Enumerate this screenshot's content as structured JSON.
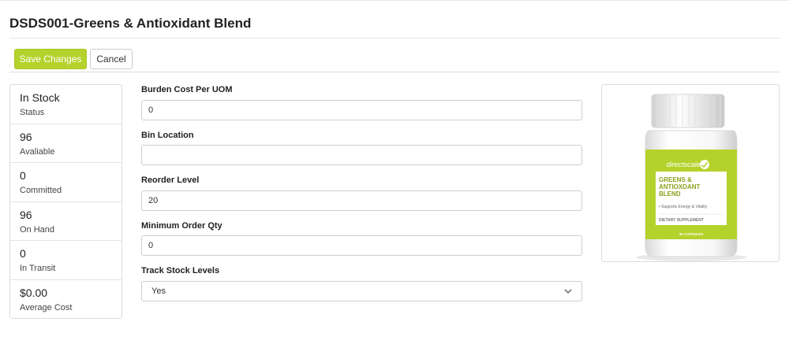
{
  "header": {
    "title": "DSDS001-Greens & Antioxidant Blend"
  },
  "toolbar": {
    "save_label": "Save Changes",
    "cancel_label": "Cancel"
  },
  "stats": [
    {
      "value": "In Stock",
      "label": "Status"
    },
    {
      "value": "96",
      "label": "Avaliable"
    },
    {
      "value": "0",
      "label": "Committed"
    },
    {
      "value": "96",
      "label": "On Hand"
    },
    {
      "value": "0",
      "label": "In Transit"
    },
    {
      "value": "$0.00",
      "label": "Average Cost"
    }
  ],
  "form": {
    "burden_cost": {
      "label": "Burden Cost Per UOM",
      "value": "0"
    },
    "bin_location": {
      "label": "Bin Location",
      "value": ""
    },
    "reorder_level": {
      "label": "Reorder Level",
      "value": "20"
    },
    "min_order_qty": {
      "label": "Minimum Order Qty",
      "value": "0"
    },
    "track_stock": {
      "label": "Track Stock Levels",
      "value": "Yes"
    }
  },
  "product_image": {
    "brand": "directscale",
    "name_line1": "GREENS &",
    "name_line2": "ANTIOXDANT",
    "name_line3": "BLEND",
    "tagline": "• Supports Energy & Vitality",
    "category": "DIETARY SUPPLEMENT",
    "count": "30 CAPSULES",
    "label_color": "#b5d22c"
  },
  "colors": {
    "accent": "#b5d22c"
  }
}
